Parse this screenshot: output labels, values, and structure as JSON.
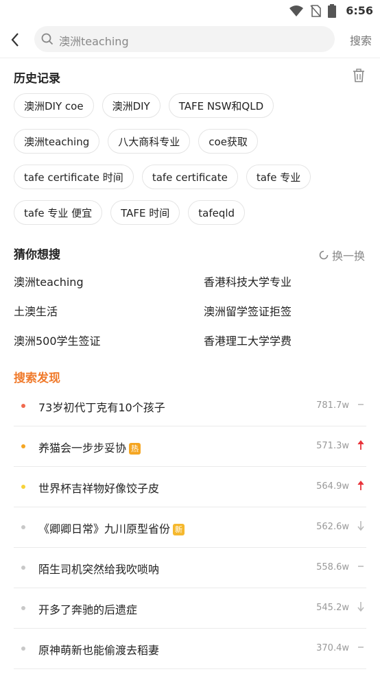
{
  "status": {
    "time": "6:56"
  },
  "header": {
    "search_value": "澳洲teaching",
    "search_button": "搜索"
  },
  "history": {
    "title": "历史记录",
    "rows": [
      [
        "澳洲DIY coe",
        "澳洲DIY",
        "TAFE NSW和QLD"
      ],
      [
        "澳洲teaching",
        "八大商科专业",
        "coe获取"
      ],
      [
        "tafe certificate 时间",
        "tafe certificate",
        "tafe 专业"
      ],
      [
        "tafe 专业 便宜",
        "TAFE 时间",
        "tafeqld"
      ]
    ]
  },
  "guess": {
    "title": "猜你想搜",
    "refresh": "换一换",
    "items": [
      "澳洲teaching",
      "香港科技大学专业",
      "土澳生活",
      "澳洲留学签证拒签",
      "澳洲500学生签证",
      "香港理工大学学费"
    ]
  },
  "discover": {
    "title": "搜索发现",
    "items": [
      {
        "text": "73岁初代丁克有10个孩子",
        "count": "781.7w",
        "dot": "#f06a4f",
        "badge": "",
        "trend": "flat"
      },
      {
        "text": "养猫会一步步妥协",
        "count": "571.3w",
        "dot": "#f5a623",
        "badge": "热",
        "badge_color": "#f5a623",
        "trend": "up"
      },
      {
        "text": "世界杯吉祥物好像饺子皮",
        "count": "564.9w",
        "dot": "#f7d23a",
        "badge": "",
        "trend": "up"
      },
      {
        "text": "《卿卿日常》九川原型省份",
        "count": "562.6w",
        "dot": "#c8c8c8",
        "badge": "新",
        "badge_color": "#f5b82e",
        "trend": "down"
      },
      {
        "text": "陌生司机突然给我吹唢呐",
        "count": "558.6w",
        "dot": "#c8c8c8",
        "badge": "",
        "trend": "flat"
      },
      {
        "text": "开多了奔驰的后遗症",
        "count": "545.2w",
        "dot": "#c8c8c8",
        "badge": "",
        "trend": "down"
      },
      {
        "text": "原神萌新也能偷渡去稻妻",
        "count": "370.4w",
        "dot": "#c8c8c8",
        "badge": "",
        "trend": "flat"
      }
    ]
  }
}
